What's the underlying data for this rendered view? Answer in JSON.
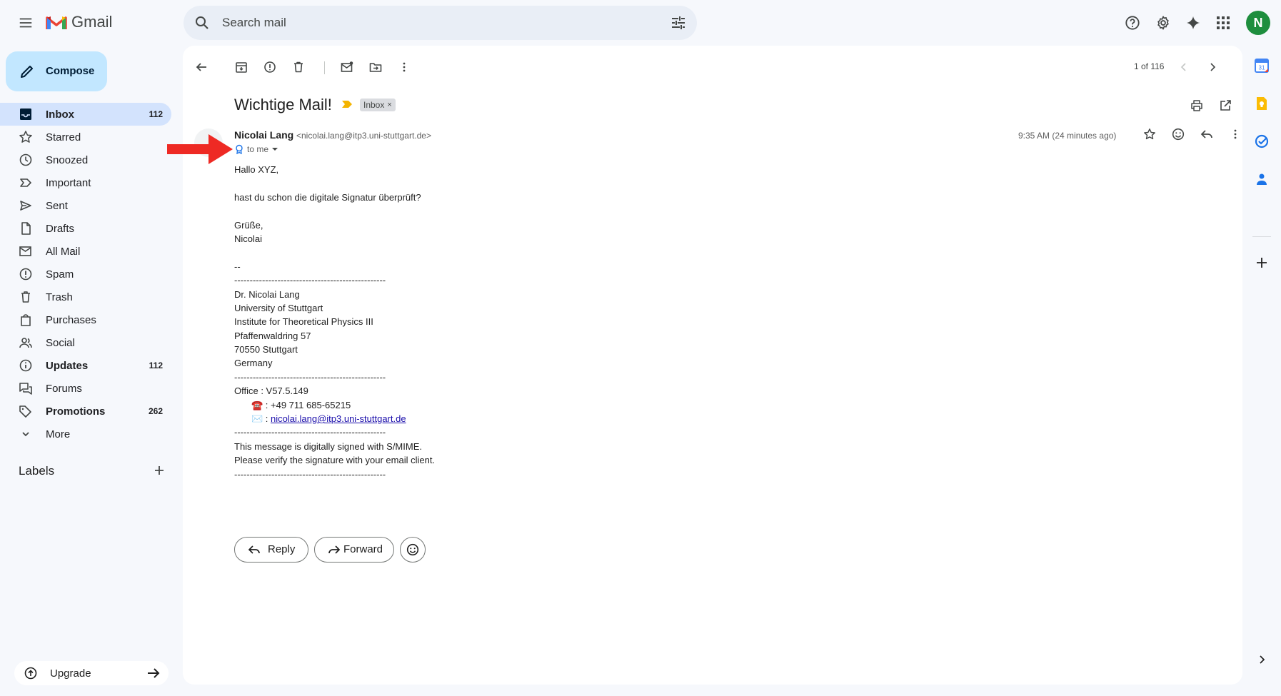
{
  "app": {
    "name": "Gmail"
  },
  "search": {
    "placeholder": "Search mail"
  },
  "compose": {
    "label": "Compose"
  },
  "nav": [
    {
      "label": "Inbox",
      "count": "112",
      "active": true,
      "bold": true,
      "icon": "inbox-icon"
    },
    {
      "label": "Starred",
      "count": "",
      "icon": "star-icon"
    },
    {
      "label": "Snoozed",
      "count": "",
      "icon": "clock-icon"
    },
    {
      "label": "Important",
      "count": "",
      "icon": "important-icon"
    },
    {
      "label": "Sent",
      "count": "",
      "icon": "send-icon"
    },
    {
      "label": "Drafts",
      "count": "",
      "icon": "draft-icon"
    },
    {
      "label": "All Mail",
      "count": "",
      "icon": "all-mail-icon"
    },
    {
      "label": "Spam",
      "count": "",
      "icon": "spam-icon"
    },
    {
      "label": "Trash",
      "count": "",
      "icon": "trash-icon"
    },
    {
      "label": "Purchases",
      "count": "",
      "icon": "shopping-bag-icon"
    },
    {
      "label": "Social",
      "count": "",
      "icon": "people-icon"
    },
    {
      "label": "Updates",
      "count": "112",
      "bold": true,
      "icon": "info-icon"
    },
    {
      "label": "Forums",
      "count": "",
      "icon": "forum-icon"
    },
    {
      "label": "Promotions",
      "count": "262",
      "bold": true,
      "icon": "tag-icon"
    },
    {
      "label": "More",
      "count": "",
      "icon": "chevron-down-icon"
    }
  ],
  "labels": {
    "heading": "Labels"
  },
  "upgrade": {
    "label": "Upgrade"
  },
  "toolbar": {
    "pager": "1 of 116"
  },
  "email": {
    "subject": "Wichtige Mail!",
    "label_chip": "Inbox",
    "sender_name": "Nicolai Lang",
    "sender_email": "<nicolai.lang@itp3.uni-stuttgart.de>",
    "to": "to me",
    "time": "9:35 AM (24 minutes ago)",
    "body": [
      "Hallo XYZ,",
      "",
      "hast du schon die digitale Signatur überprüft?",
      "",
      "Grüße,",
      "Nicolai",
      "",
      "--",
      "-------------------------------------------------",
      "Dr. Nicolai Lang",
      "University of Stuttgart",
      "Institute for Theoretical Physics III",
      "Pfaffenwaldring 57",
      "70550 Stuttgart",
      "Germany",
      "-------------------------------------------------",
      "Office : V57.5.149"
    ],
    "phone": "☎️ : +49 711 685-65215",
    "mail_prefix": "✉️ : ",
    "mail_link": "nicolai.lang@itp3.uni-stuttgart.de",
    "body_footer": [
      "-------------------------------------------------",
      "This message is digitally signed with S/MIME.",
      "Please verify the signature with your email client.",
      "-------------------------------------------------"
    ]
  },
  "actions": {
    "reply": "Reply",
    "forward": "Forward"
  },
  "user": {
    "initial": "N"
  }
}
